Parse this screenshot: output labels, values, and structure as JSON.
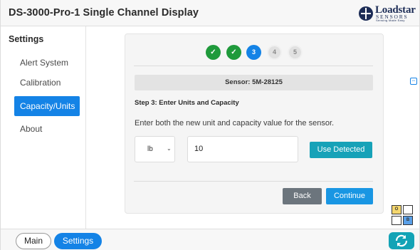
{
  "app": {
    "title": "DS-3000-Pro-1 Single Channel Display"
  },
  "logo": {
    "word": "Loadstar",
    "sub": "SENSORS",
    "tag": "Sensing Made Easy"
  },
  "sidebar": {
    "heading": "Settings",
    "items": [
      {
        "label": "Alert System",
        "active": false
      },
      {
        "label": "Calibration",
        "active": false
      },
      {
        "label": "Capacity/Units",
        "active": true
      },
      {
        "label": "About",
        "active": false
      }
    ]
  },
  "wizard": {
    "steps": [
      {
        "label": "✓",
        "state": "done"
      },
      {
        "label": "✓",
        "state": "done"
      },
      {
        "label": "3",
        "state": "current"
      },
      {
        "label": "4",
        "state": "todo"
      },
      {
        "label": "5",
        "state": "todo"
      }
    ],
    "sensor_label": "Sensor: 5M-28125",
    "step_title": "Step 3: Enter Units and Capacity",
    "instruction": "Enter both the new unit and capacity value for the sensor.",
    "unit_value": "lb",
    "capacity_value": "10",
    "use_detected_label": "Use Detected",
    "back_label": "Back",
    "continue_label": "Continue"
  },
  "mini_grid": {
    "cells": [
      "O",
      "",
      "",
      "B"
    ]
  },
  "footer": {
    "main_label": "Main",
    "settings_label": "Settings"
  },
  "colors": {
    "accent": "#1483e6",
    "success": "#1f9a3b",
    "info": "#17a2b8",
    "secondary": "#6c757d"
  }
}
